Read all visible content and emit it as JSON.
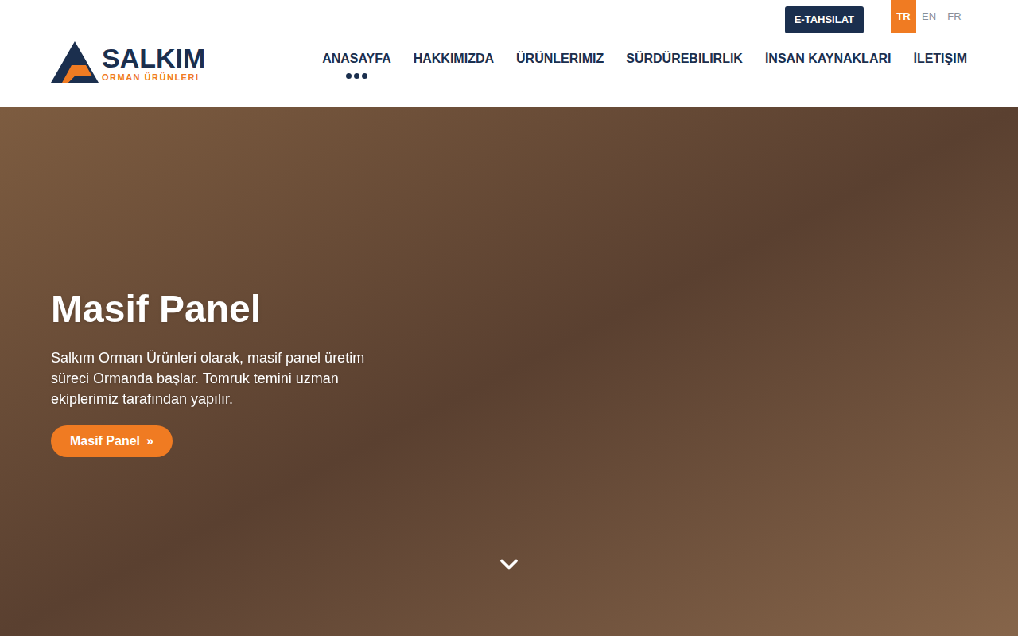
{
  "header": {
    "logo": {
      "name": "SALKIM",
      "tagline": "ORMAN ÜRÜNLERI"
    },
    "payment_button": "E-TAHSILAT",
    "languages": [
      {
        "label": "TR",
        "selected": true
      },
      {
        "label": "EN",
        "selected": false
      },
      {
        "label": "FR",
        "selected": false
      }
    ],
    "nav": [
      {
        "label": "ANASAYFA",
        "selected": true
      },
      {
        "label": "HAKKIMIZDA",
        "selected": false
      },
      {
        "label": "ÜRÜNLERIMIZ",
        "selected": false
      },
      {
        "label": "SÜRDÜREBILIRLIK",
        "selected": false
      },
      {
        "label": "İNSAN KAYNAKLARI",
        "selected": false
      },
      {
        "label": "İLETIŞIM",
        "selected": false
      }
    ]
  },
  "hero": {
    "title": "Masif Panel",
    "text": "Salkım Orman Ürünleri olarak, masif panel üretim süreci Ormanda başlar. Tomruk temini uzman ekiplerimiz tarafından yapılır.",
    "button": "Masif Panel",
    "button_icon": "»"
  }
}
